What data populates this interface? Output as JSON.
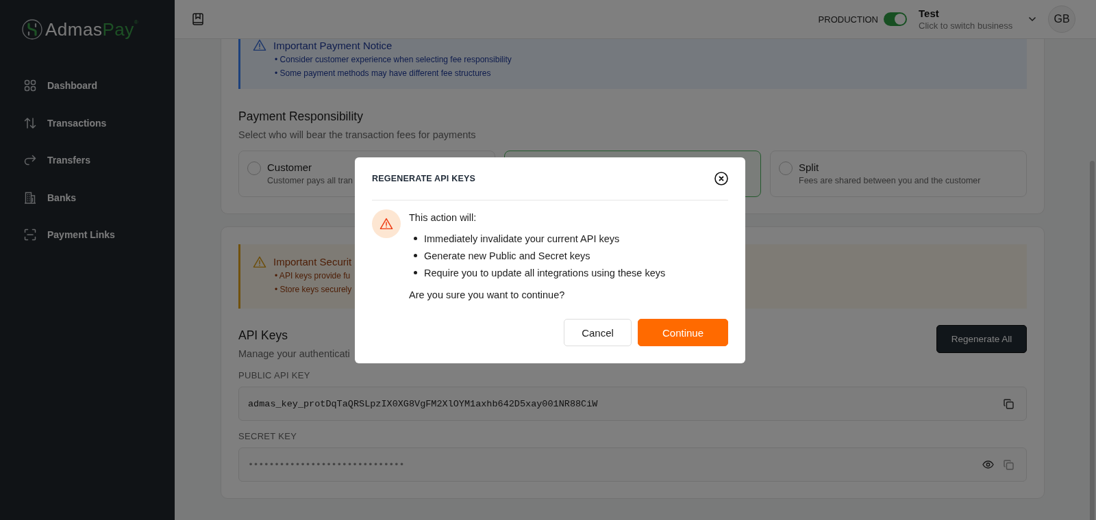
{
  "sidebar": {
    "logo": {
      "word": "Admas",
      "accent": "Pay",
      "mark": "®"
    },
    "items": [
      {
        "label": "Dashboard",
        "selected": false
      },
      {
        "label": "Transactions",
        "selected": false
      },
      {
        "label": "Transfers",
        "selected": false
      },
      {
        "label": "Banks",
        "selected": false
      },
      {
        "label": "Payment Links",
        "selected": false
      }
    ]
  },
  "header": {
    "environment": {
      "label": "PRODUCTION",
      "on": true
    },
    "business": {
      "name": "Test",
      "hint": "Click to switch business"
    },
    "avatar": "GB"
  },
  "payment_notice": {
    "title": "Important Payment Notice",
    "bullets": [
      "• Consider customer experience when selecting fee responsibility",
      "• Some payment methods may have different fee structures"
    ]
  },
  "payment_responsibility": {
    "title": "Payment Responsibility",
    "subtitle": "Select who will bear the transaction fees for payments",
    "options": [
      {
        "label": "Customer",
        "description": "Customer pays all tran",
        "selected": false
      },
      {
        "selected": true
      },
      {
        "label": "Split",
        "description": "Fees are shared between you and the customer",
        "selected": false
      }
    ]
  },
  "security_notice": {
    "title": "Important Securit",
    "bullets": [
      "• API keys provide fu",
      "• Store keys securely"
    ]
  },
  "api_keys": {
    "title": "API Keys",
    "subtitle": "Manage your authenticati",
    "button": "Regenerate All",
    "fields": [
      {
        "label": "PUBLIC API KEY",
        "value": "admas_key_protDqTaQRSLpzIX0XG8VgFM2XlOYM1axhb642D5xay001NR88CiW",
        "masked": false
      },
      {
        "label": "SECRET KEY",
        "value": "••••••••••••••••••••••••••••••",
        "masked": true
      }
    ]
  },
  "dialog": {
    "title": "REGENERATE API KEYS",
    "intro": "This action will:",
    "bullets": [
      "Immediately invalidate your current API keys",
      "Generate new Public and Secret keys",
      "Require you to update all integrations using these keys"
    ],
    "question": "Are you sure you want to continue?",
    "buttons": [
      {
        "label": "Cancel",
        "kind": "secondary"
      },
      {
        "label": "Continue",
        "kind": "primary"
      }
    ]
  }
}
